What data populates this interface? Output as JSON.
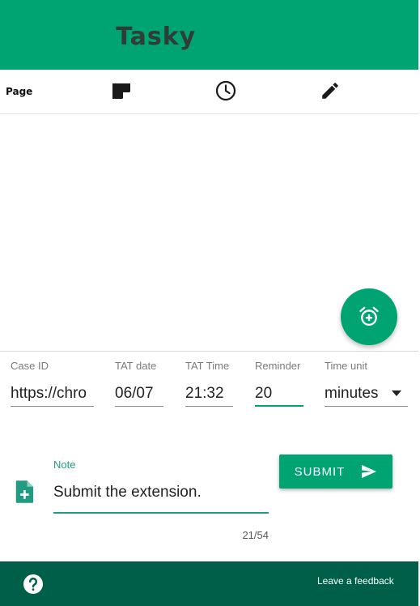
{
  "app": {
    "title": "Tasky"
  },
  "tabs": [
    {
      "label": "Page",
      "icon": "page-tab"
    },
    {
      "label": "",
      "icon": "note-icon"
    },
    {
      "label": "",
      "icon": "clock-icon"
    },
    {
      "label": "",
      "icon": "pencil-icon"
    }
  ],
  "fab": {
    "icon": "add-alarm-icon"
  },
  "form": {
    "case_id": {
      "label": "Case ID",
      "value": "https://chro"
    },
    "tat_date": {
      "label": "TAT date",
      "value": "06/07"
    },
    "tat_time": {
      "label": "TAT Time",
      "value": "21:32"
    },
    "reminder": {
      "label": "Reminder",
      "value": "20"
    },
    "time_unit": {
      "label": "Time unit",
      "value": "minutes"
    },
    "note": {
      "label": "Note",
      "value": "Submit the extension.",
      "counter": "21/54"
    },
    "submit_label": "SUBMIT"
  },
  "footer": {
    "feedback_label": "Leave a feedback",
    "help_icon": "help-circle-icon"
  },
  "colors": {
    "primary": "#00a372",
    "footer": "#005f48",
    "note_accent": "#1f9c82"
  }
}
